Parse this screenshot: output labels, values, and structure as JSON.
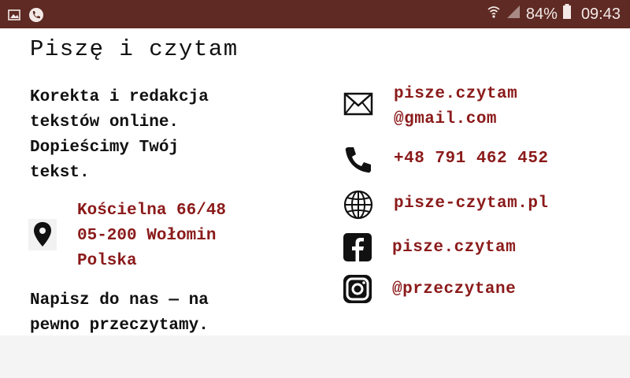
{
  "statusbar": {
    "battery": "84%",
    "time": "09:43",
    "icons": [
      "image-icon",
      "phone-call-icon",
      "wifi-icon",
      "signal-icon",
      "battery-icon"
    ]
  },
  "card": {
    "title": "Piszę i czytam",
    "intro": [
      "Korekta i redakcja",
      "tekstów online.",
      "Dopieścimy Twój",
      "tekst."
    ],
    "address": {
      "line1": "Kościelna 66/48",
      "line2": "05-200 Wołomin",
      "line3": "Polska"
    },
    "outro": [
      "Napisz do nas — na",
      "pewno przeczytamy."
    ]
  },
  "contacts": {
    "email_line1": "pisze.czytam",
    "email_line2": "@gmail.com",
    "phone": "+48 791 462 452",
    "website": "pisze-czytam.pl",
    "facebook": "pisze.czytam",
    "instagram": "@przeczytane"
  },
  "colors": {
    "statusbar": "#5e2a23",
    "accent_text": "#8b1a1a",
    "body_text": "#111111"
  }
}
